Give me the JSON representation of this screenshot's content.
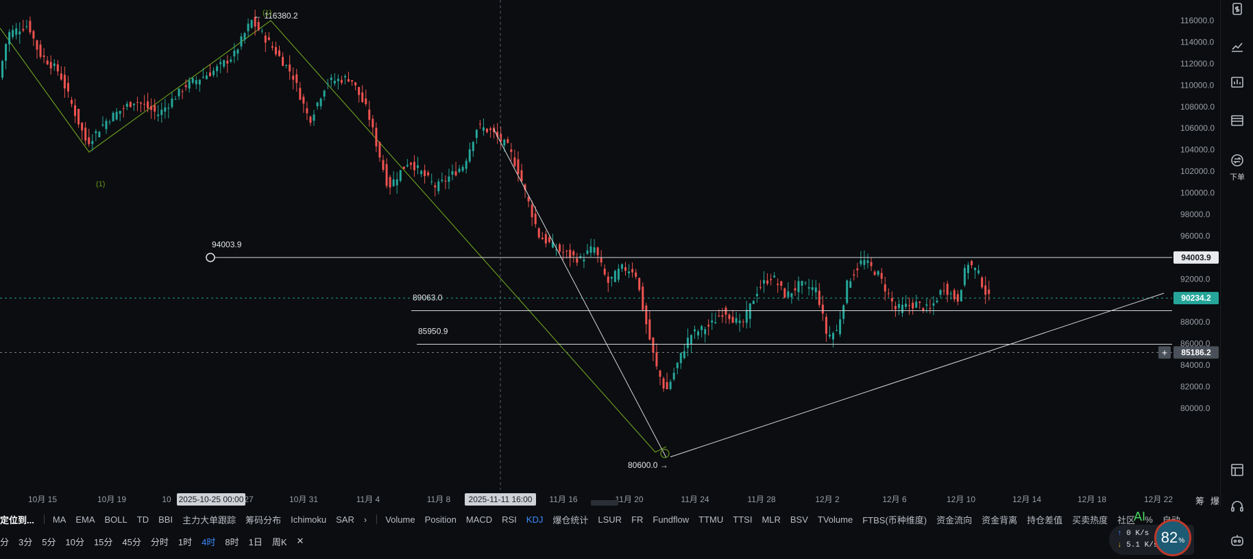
{
  "chart_data": {
    "type": "candlestick",
    "price_axis": {
      "ticks": [
        "116000.0",
        "114000.0",
        "112000.0",
        "110000.0",
        "108000.0",
        "106000.0",
        "104000.0",
        "102000.0",
        "100000.0",
        "98000.0",
        "96000.0",
        "94000.0",
        "92000.0",
        "90000.0",
        "88000.0",
        "86000.0",
        "84000.0",
        "82000.0",
        "80000.0"
      ],
      "range": [
        79200,
        117600
      ]
    },
    "time_axis": {
      "ticks": [
        "10月 15",
        "10月 19",
        "10",
        "27",
        "10月 31",
        "11月 4",
        "11月 8",
        "11月 16",
        "11月 20",
        "11月 24",
        "11月 28",
        "12月 2",
        "12月 6",
        "12月 10",
        "12月 14",
        "12月 18",
        "12月 22"
      ],
      "crosshair_label_1": "2025-10-25 00:00",
      "crosshair_label_2": "2025-11-11 16:00"
    },
    "price_tags": {
      "level_1": "94003.9",
      "current": "90234.2",
      "crosshair": "85186.2"
    },
    "horizontal_levels": [
      {
        "label": "94003.9",
        "value": 94003.9
      },
      {
        "label": "89063.0",
        "value": 89063.0
      },
      {
        "label": "85950.9",
        "value": 85950.9
      }
    ],
    "annotations": {
      "high": "116380.2",
      "low": "80600.0",
      "wave_label": "(1)",
      "wave_label_2": "(1)"
    },
    "colors": {
      "up": "#26a69a",
      "down": "#ef5350",
      "background": "#0b0d10",
      "wave_line": "#6a9a1f",
      "current_tag": "#26a69a"
    }
  },
  "right_rail": {
    "icons": [
      "dollar-icon",
      "trend-icon",
      "bar-chart-icon",
      "table-icon",
      "swap-icon",
      "layout-icon",
      "headset-icon",
      "bot-icon"
    ],
    "download_label": "下单"
  },
  "indicator_bar": {
    "locate": "定位到...",
    "main": [
      "MA",
      "EMA",
      "BOLL",
      "TD",
      "BBI",
      "主力大单跟踪",
      "筹码分布",
      "Ichimoku",
      "SAR"
    ],
    "sub": [
      "Volume",
      "Position",
      "MACD",
      "RSI",
      "KDJ",
      "爆仓统计",
      "LSUR",
      "FR",
      "Fundflow",
      "TTMU",
      "TTSI",
      "MLR",
      "BSV",
      "TVolume",
      "FTBS(币种维度)",
      "资金流向",
      "资金背离",
      "持仓差值",
      "买卖热度",
      "社区",
      "%",
      "自动"
    ],
    "active_sub": "KDJ"
  },
  "right_corner": {
    "a": "筹",
    "b": "爆",
    "ai": "AI"
  },
  "timeframes": {
    "items": [
      "分",
      "3分",
      "5分",
      "10分",
      "15分",
      "45分",
      "分时",
      "1时",
      "4时",
      "8时",
      "1日",
      "周K"
    ],
    "active": "4时",
    "close": "✕"
  },
  "network": {
    "up": "0 K/s",
    "down": "5.1 K/s",
    "percent": "82",
    "unit": "%"
  }
}
